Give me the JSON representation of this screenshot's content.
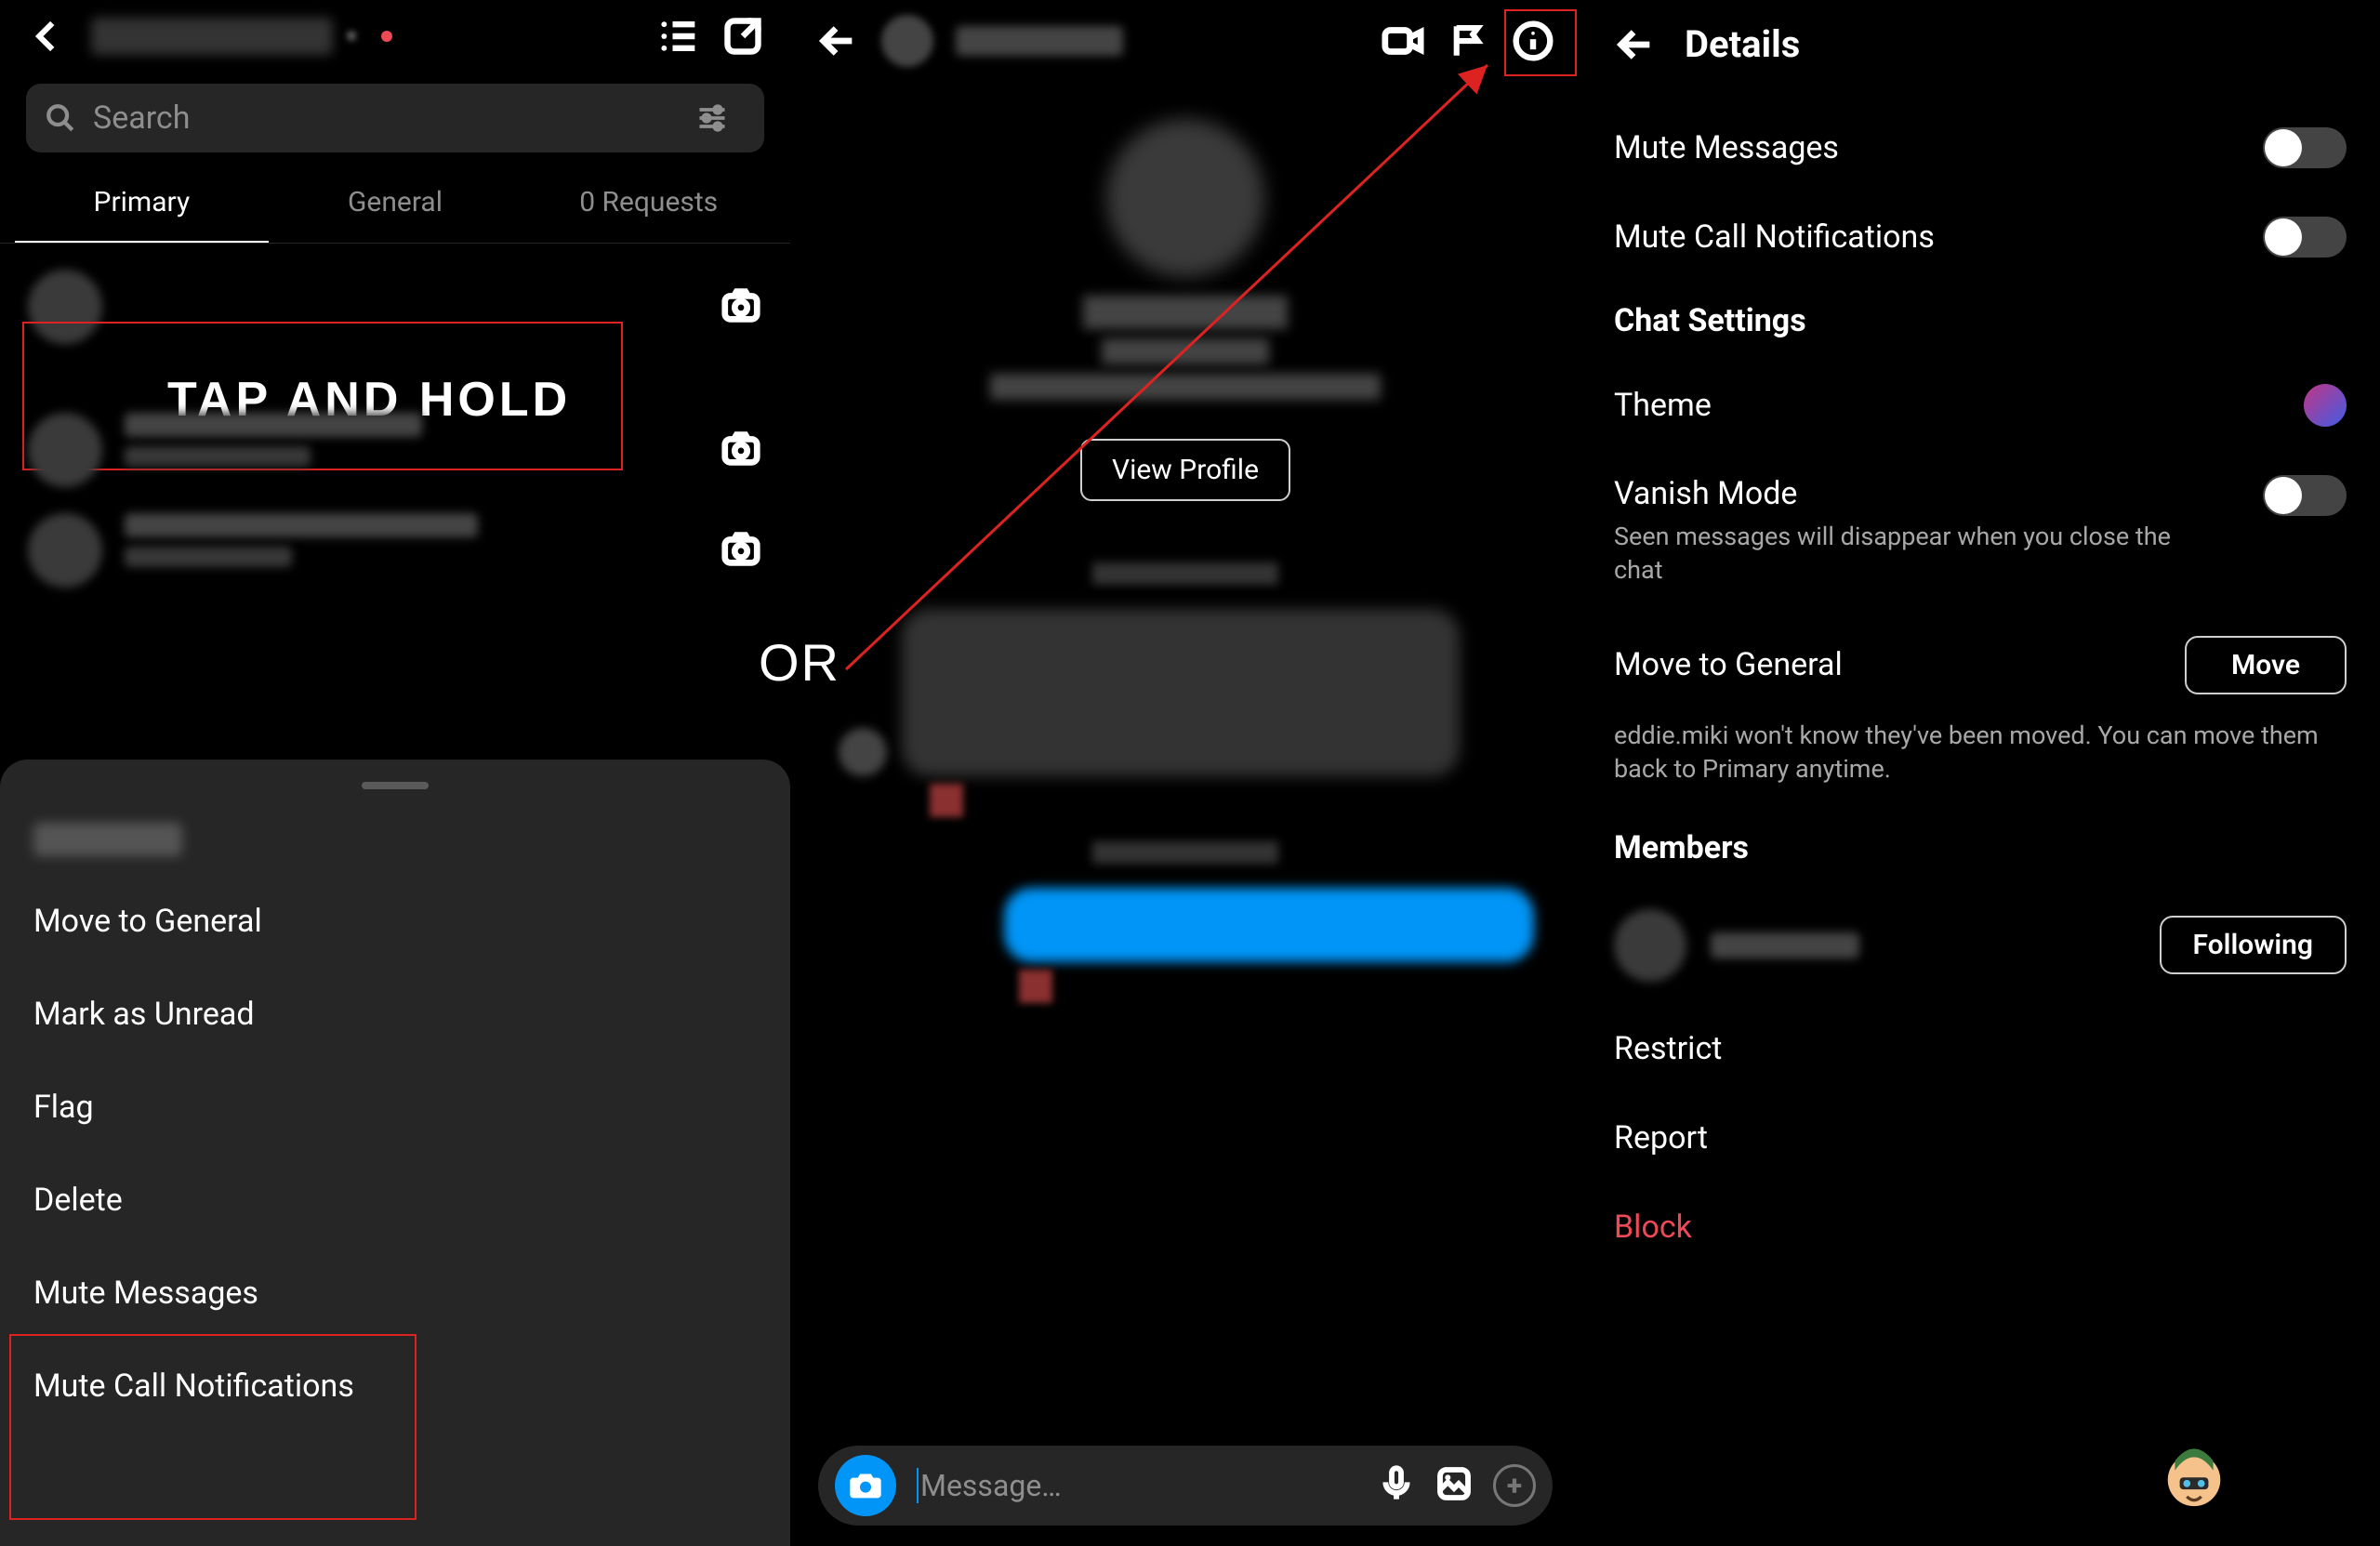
{
  "panel1": {
    "search_placeholder": "Search",
    "tabs": {
      "primary": "Primary",
      "general": "General",
      "requests": "0 Requests"
    },
    "tap_hold_overlay": "TAP AND HOLD",
    "sheet": {
      "move": "Move to General",
      "unread": "Mark as Unread",
      "flag": "Flag",
      "delete": "Delete",
      "mute_msg": "Mute Messages",
      "mute_call": "Mute Call Notifications"
    }
  },
  "panel2": {
    "view_profile": "View Profile",
    "message_placeholder": "Message…"
  },
  "or_label": "OR",
  "panel3": {
    "title": "Details",
    "mute_messages": "Mute Messages",
    "mute_calls": "Mute Call Notifications",
    "chat_settings": "Chat Settings",
    "theme": "Theme",
    "vanish": "Vanish Mode",
    "vanish_sub": "Seen messages will disappear when you close the chat",
    "move_general": "Move to General",
    "move_btn": "Move",
    "move_sub": "eddie.miki won't know they've been moved. You can move them back to Primary anytime.",
    "members": "Members",
    "following": "Following",
    "restrict": "Restrict",
    "report": "Report",
    "block": "Block"
  }
}
